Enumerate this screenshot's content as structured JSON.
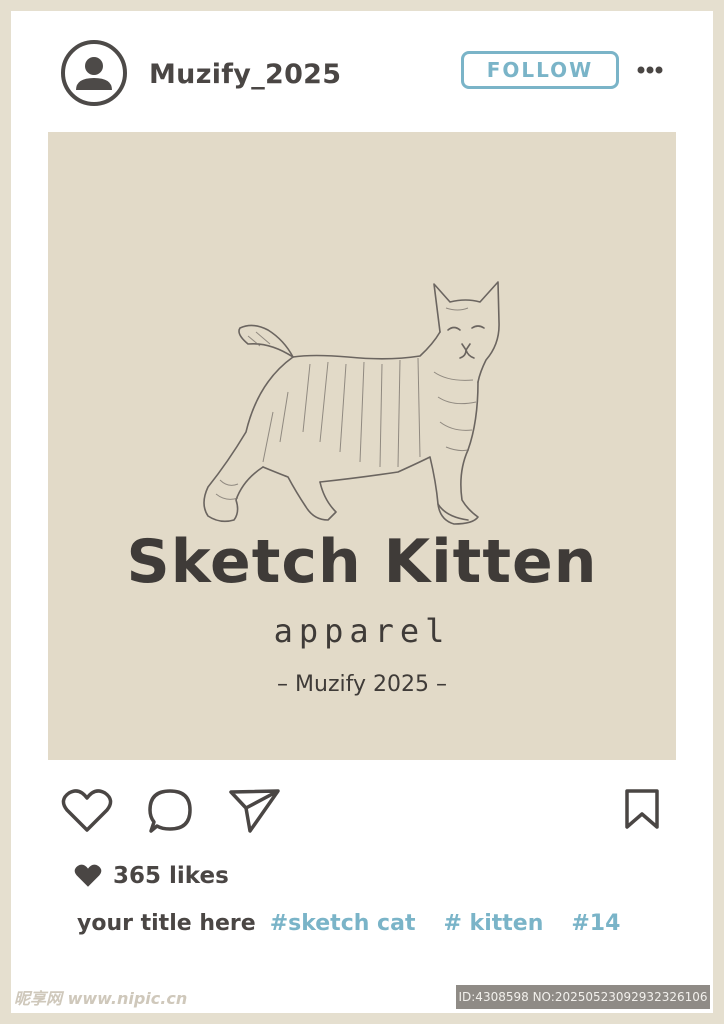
{
  "post": {
    "username": "Muzify_2025",
    "follow_label": "FOLLOW",
    "likes": "365 likes",
    "caption_title": "your title here",
    "hashtags": [
      "#sketch cat",
      "# kitten",
      "#14"
    ]
  },
  "image": {
    "brand_title": "Sketch Kitten",
    "brand_subtitle": "apparel",
    "brand_credit": "– Muzify 2025 –"
  },
  "watermark": {
    "site": "昵享网 www.nipic.cn",
    "id_text": "ID:4308598 NO:20250523092932326106"
  },
  "colors": {
    "frame": "#e5dfcf",
    "image_bg": "#e2dac8",
    "text": "#4a4644",
    "accent": "#7ab4c8"
  },
  "icons": {
    "avatar": "user-icon",
    "more": "more-dots-icon",
    "like": "heart-icon",
    "comment": "comment-icon",
    "share": "send-icon",
    "save": "bookmark-icon",
    "likes": "heart-filled-icon"
  }
}
